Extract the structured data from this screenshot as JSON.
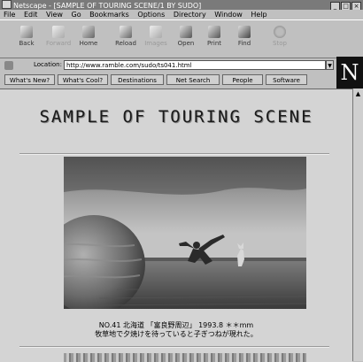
{
  "window": {
    "title": "Netscape - [SAMPLE OF TOURING SCENE/1 BY SUDO]",
    "controls": [
      "_",
      "□",
      "×"
    ]
  },
  "menu": [
    "File",
    "Edit",
    "View",
    "Go",
    "Bookmarks",
    "Options",
    "Directory",
    "Window",
    "Help"
  ],
  "toolbar": [
    {
      "label": "Back",
      "icon": "back-arrow-icon",
      "enabled": true
    },
    {
      "label": "Forward",
      "icon": "forward-arrow-icon",
      "enabled": false
    },
    {
      "label": "Home",
      "icon": "home-icon",
      "enabled": true
    },
    {
      "label": "Reload",
      "icon": "reload-icon",
      "enabled": true
    },
    {
      "label": "Images",
      "icon": "images-icon",
      "enabled": false
    },
    {
      "label": "Open",
      "icon": "open-icon",
      "enabled": true
    },
    {
      "label": "Print",
      "icon": "print-icon",
      "enabled": true
    },
    {
      "label": "Find",
      "icon": "find-icon",
      "enabled": true
    },
    {
      "label": "Stop",
      "icon": "stop-icon",
      "enabled": false
    }
  ],
  "location": {
    "label": "Location:",
    "url": "http://www.ramble.com/sudo/ts041.html"
  },
  "logo": "N",
  "directory_buttons": [
    "What's New?",
    "What's Cool?",
    "Destinations",
    "Net Search",
    "People",
    "Software"
  ],
  "page": {
    "heading": "SAMPLE OF TOURING SCENE",
    "caption_line1": "NO.41 北海道 「富良野周辺」 1993.8 ＊＊mm",
    "caption_line2": "牧草地で夕焼けを待っていると子ぎつねが現れた。"
  },
  "colors": {
    "content_bg": "#d4d4d4",
    "chrome_bg": "#c0c0c0",
    "titlebar_bg": "#7a7a7a"
  }
}
